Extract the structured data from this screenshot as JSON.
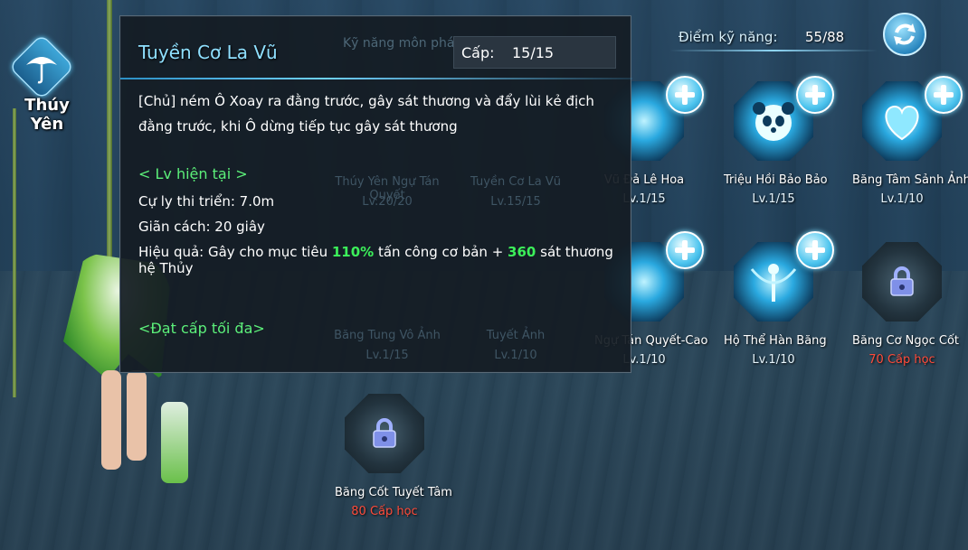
{
  "character": {
    "name": "Thúy Yên"
  },
  "header": {
    "skill_points_label": "Điểm kỹ năng:",
    "skill_points_value": "55/88",
    "refresh_icon": "refresh-icon"
  },
  "skills": [
    {
      "name": "Vũ Đả Lê Hoa",
      "level": "Lv.1/15",
      "state": "upgradable"
    },
    {
      "name": "Triệu Hồi Bảo Bảo",
      "level": "Lv.1/15",
      "state": "upgradable"
    },
    {
      "name": "Băng Tâm Sảnh Ảnh",
      "level": "Lv.1/10",
      "state": "upgradable"
    },
    {
      "name": "Ngự Tán Quyết-Cao",
      "level": "Lv.1/10",
      "state": "upgradable"
    },
    {
      "name": "Hộ Thể Hàn Băng",
      "level": "Lv.1/10",
      "state": "upgradable"
    },
    {
      "name": "Băng Cơ Ngọc Cốt",
      "level": "70 Cấp học",
      "state": "locked"
    },
    {
      "name": "Băng Cốt Tuyết Tâm",
      "level": "80 Cấp học",
      "state": "locked"
    }
  ],
  "ghost_skills": [
    {
      "name": "Thúy Yên Ngự Tán Quyết",
      "level": "Lv.20/20"
    },
    {
      "name": "Tuyền Cơ La Vũ",
      "level": "Lv.15/15"
    },
    {
      "name": "Băng Tung Vô Ảnh",
      "level": "Lv.1/15"
    },
    {
      "name": "Tuyết Ảnh",
      "level": "Lv.1/10"
    }
  ],
  "tooltip": {
    "header_ghost": "Kỹ năng môn phái",
    "title": "Tuyền Cơ La Vũ",
    "level_label": "Cấp:",
    "level_value": "15/15",
    "description": "[Chủ] ném Ô Xoay ra đằng trước, gây sát thương và đẩy lùi kẻ địch đằng trước, khi Ô dừng tiếp tục gây sát thương",
    "current_level_heading": "< Lv hiện tại >",
    "range": "Cự ly thi triển: 7.0m",
    "cooldown": "Giãn cách: 20 giây",
    "effect_prefix": "Hiệu quả: Gây cho mục tiêu ",
    "effect_percent": "110%",
    "effect_mid": " tấn công cơ bản + ",
    "effect_damage": "360",
    "effect_suffix": " sát thương hệ Thủy",
    "max_level_note": "<Đạt cấp tối đa>"
  },
  "colors": {
    "title": "#8fe0ff",
    "green_highlight": "#3cf05a",
    "requirement_red": "#ff4b3a"
  }
}
